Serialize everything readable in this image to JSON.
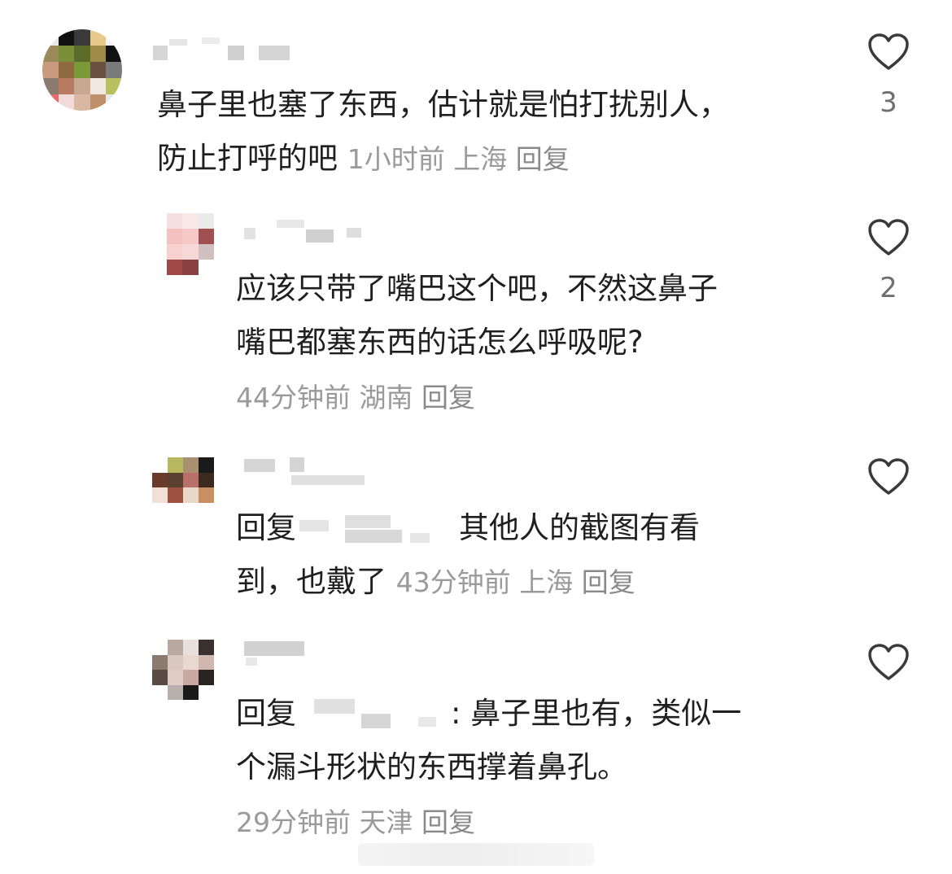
{
  "comments": [
    {
      "text_line1": "鼻子里也塞了东西，估计就是怕打扰别人，",
      "text_line2": "防止打呼的吧",
      "time": "1小时前",
      "location": "上海",
      "reply_label": "回复",
      "likes": "3"
    },
    {
      "text_line1": "应该只带了嘴巴这个吧，不然这鼻子",
      "text_line2": "嘴巴都塞东西的话怎么呼吸呢?",
      "time": "44分钟前",
      "location": "湖南",
      "reply_label": "回复",
      "likes": "2"
    },
    {
      "reply_prefix": "回复",
      "text_line1_after": "其他人的截图有看",
      "text_line2": "到，也戴了",
      "time": "43分钟前",
      "location": "上海",
      "reply_label": "回复",
      "likes": ""
    },
    {
      "reply_prefix": "回复",
      "text_line1_after": ": 鼻子里也有，类似一",
      "text_line2": "个漏斗形状的东西撑着鼻孔。",
      "time": "29分钟前",
      "location": "天津",
      "reply_label": "回复",
      "likes": ""
    }
  ],
  "icons": {
    "like": "heart-outline-icon"
  },
  "colors": {
    "text": "#1f1f1f",
    "meta": "#9a9a9a",
    "icon": "#3a3a3a"
  }
}
